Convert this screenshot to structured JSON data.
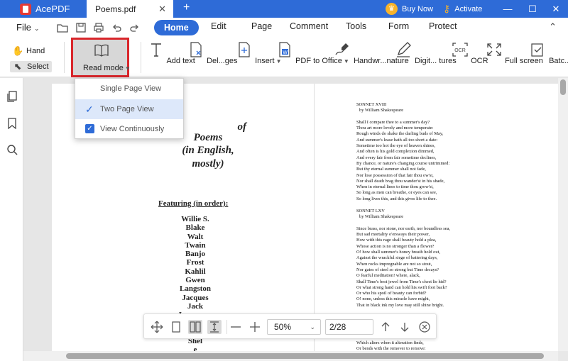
{
  "titlebar": {
    "app_name": "AcePDF",
    "tab_name": "Poems.pdf",
    "close_tab": "✕",
    "new_tab": "+",
    "buy_now": "Buy Now",
    "activate": "Activate",
    "accent_color": "#2e6bd7"
  },
  "menubar": {
    "file": "File",
    "tabs": [
      "Home",
      "Edit",
      "Page",
      "Comment",
      "Tools",
      "Form",
      "Protect"
    ],
    "active_tab": "Home"
  },
  "ribbon": {
    "hand": "Hand",
    "select": "Select",
    "read_mode": "Read mode",
    "tools": [
      {
        "label": "Add text",
        "icon": "add-text-icon"
      },
      {
        "label": "Del...ges",
        "icon": "delete-pages-icon"
      },
      {
        "label": "Insert",
        "icon": "insert-icon"
      },
      {
        "label": "PDF to Office",
        "icon": "pdf-to-office-icon"
      },
      {
        "label": "Handwr...nature",
        "icon": "handwritten-signature-icon"
      },
      {
        "label": "Digit... tures",
        "icon": "digital-signature-icon"
      },
      {
        "label": "OCR",
        "icon": "ocr-icon"
      },
      {
        "label": "Full screen",
        "icon": "full-screen-icon"
      },
      {
        "label": "Batc...ocess",
        "icon": "batch-process-icon"
      }
    ],
    "highlight_color": "#d9262b"
  },
  "read_mode_menu": {
    "items": [
      "Single Page View",
      "Two Page View",
      "View Continuously"
    ],
    "selected": "Two Page View",
    "checked": "View Continuously"
  },
  "document": {
    "left_page": {
      "title_lines": [
        "of",
        "Poems",
        "(in English,",
        "mostly)"
      ],
      "featuring": "Featuring (in order):",
      "names": [
        "Willie S.",
        "Blake",
        "Walt",
        "Twain",
        "Banjo",
        "Frost",
        "Kahlil",
        "Gwen",
        "Langston",
        "Jacques",
        "Jack",
        "Lawrence",
        "",
        "",
        "Shel",
        "e"
      ]
    },
    "right_page": {
      "sonnet1": {
        "title": "SONNET XVIII",
        "author": "by William Shakespeare",
        "lines": [
          "Shall I compare thee to a summer's day?",
          "Thou art more lovely and more temperate:",
          "Rough winds do shake the darling buds of May,",
          "And summer's lease hath all too short a date:",
          "Sometime too hot the eye of heaven shines,",
          "And often is his gold complexion dimmed,",
          "And every fair from fair sometime declines,",
          "By chance, or nature's changing course untrimmed:",
          "But thy eternal summer shall not fade,",
          "Nor lose possession of that fair thou ow'st,",
          "Nor shall death brag thou wander'st in his shade,",
          "When in eternal lines to time thou grow'st,",
          "So long as men can breathe, or eyes can see,",
          "So long lives this, and this gives life to thee."
        ]
      },
      "sonnet2": {
        "title": "SONNET LXV",
        "author": "by William Shakespeare",
        "lines": [
          "Since brass, nor stone, nor earth, nor boundless sea,",
          "But sad mortality o'ersways their power,",
          "How with this rage shall beauty hold a plea,",
          "Whose action is no stronger than a flower?",
          "O! how shall summer's honey breath hold out,",
          "Against the wrackful siege of battering days,",
          "When rocks impregnable are not so stout,",
          "Nor gates of steel so strong but Time decays?",
          "O fearful meditation! where, alack,",
          "Shall Time's best jewel from Time's chest lie hid?",
          "Or what strong hand can hold his swift foot back?",
          "Or who his spoil of beauty can forbid?",
          "O! none, unless this miracle have might,",
          "That in black ink my love may still shine bright."
        ],
        "partial_lines": [
          "Which alters when it alteration finds,",
          "Or bends with the remover to remove:"
        ]
      }
    }
  },
  "navbar": {
    "zoom": "50%",
    "page": "2/28"
  }
}
